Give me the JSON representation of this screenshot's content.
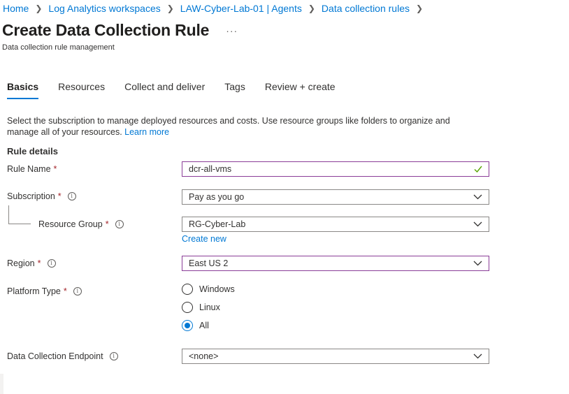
{
  "breadcrumb": [
    "Home",
    "Log Analytics workspaces",
    "LAW-Cyber-Lab-01 | Agents",
    "Data collection rules"
  ],
  "page": {
    "title": "Create Data Collection Rule",
    "more": "···",
    "subtitle": "Data collection rule management"
  },
  "tabs": [
    "Basics",
    "Resources",
    "Collect and deliver",
    "Tags",
    "Review + create"
  ],
  "active_tab": "Basics",
  "description": {
    "text": "Select the subscription to manage deployed resources and costs. Use resource groups like folders to organize and manage all of your resources.",
    "link": "Learn more"
  },
  "section_title": "Rule details",
  "form": {
    "rule_name": {
      "label": "Rule Name",
      "required": "*",
      "value": "dcr-all-vms"
    },
    "subscription": {
      "label": "Subscription",
      "required": "*",
      "info": "i",
      "value": "Pay as you go"
    },
    "resource_group": {
      "label": "Resource Group",
      "required": "*",
      "info": "i",
      "value": "RG-Cyber-Lab",
      "create_new": "Create new"
    },
    "region": {
      "label": "Region",
      "required": "*",
      "info": "i",
      "value": "East US 2"
    },
    "platform_type": {
      "label": "Platform Type",
      "required": "*",
      "info": "i",
      "options": [
        "Windows",
        "Linux",
        "All"
      ],
      "selected": "All"
    },
    "endpoint": {
      "label": "Data Collection Endpoint",
      "info": "i",
      "value": "<none>"
    }
  },
  "colors": {
    "accent": "#0078d4",
    "required": "#a4262c",
    "focus_border": "#8a3c97",
    "valid": "#57a300"
  }
}
